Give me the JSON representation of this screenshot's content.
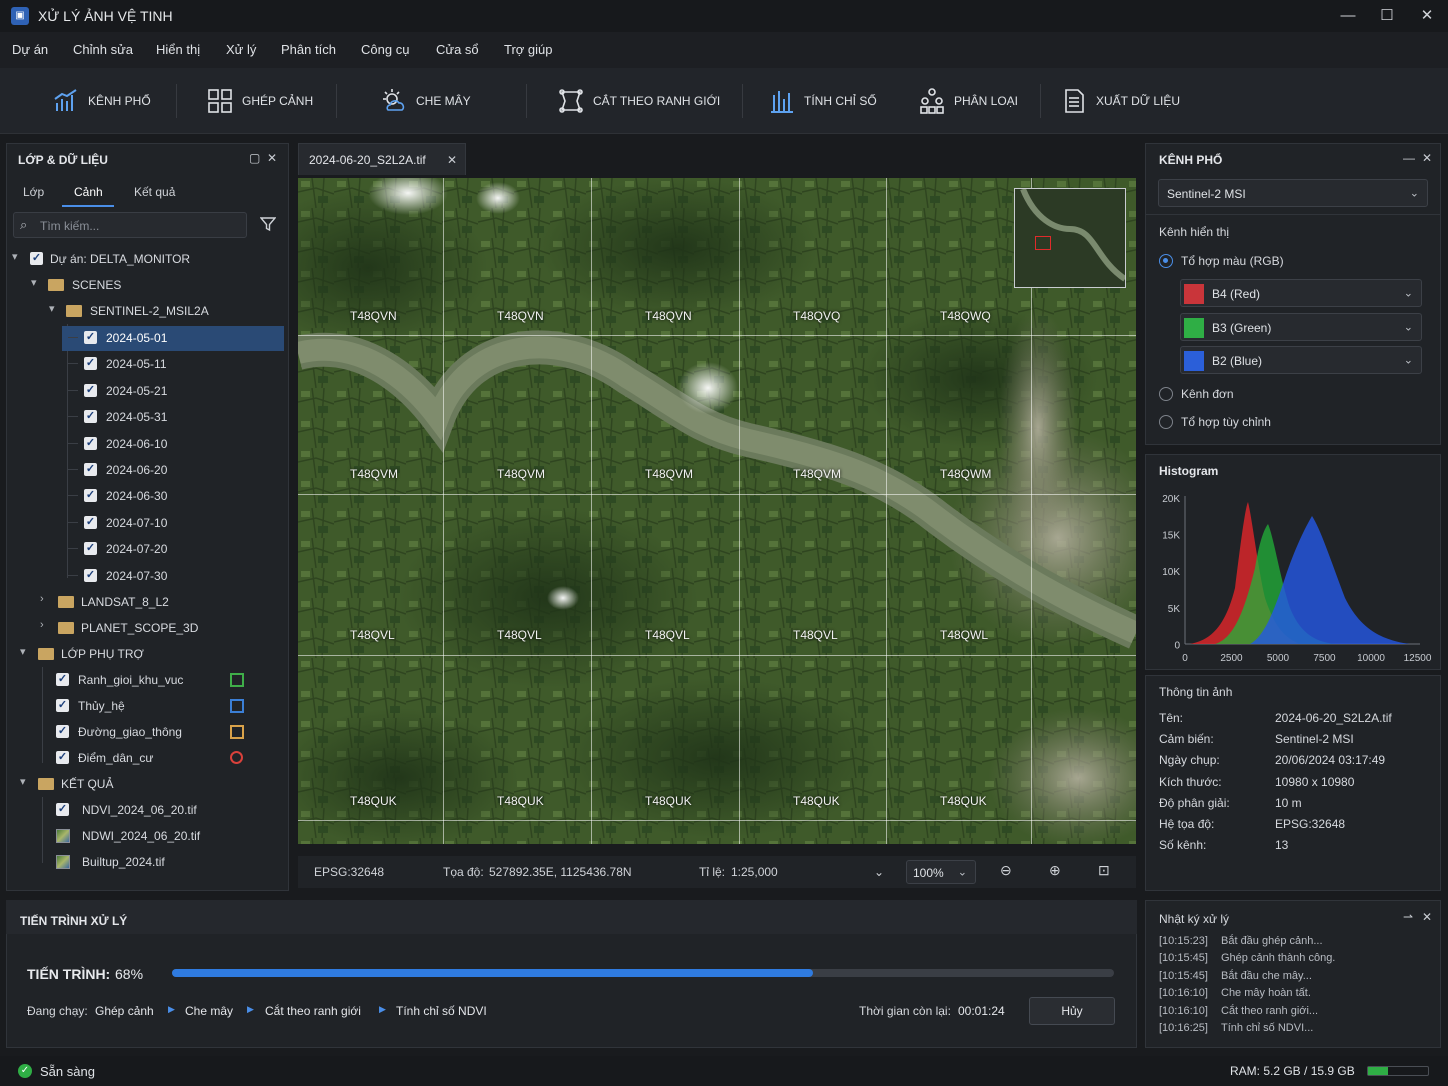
{
  "app": {
    "title": "XỬ LÝ ẢNH VỆ TINH",
    "icon": "satellite-app-icon"
  },
  "window_controls": {
    "minimize": "—",
    "maximize": "☐",
    "close": "✕"
  },
  "menu": [
    "Dự án",
    "Chỉnh sửa",
    "Hiển thị",
    "Xử lý",
    "Phân tích",
    "Công cụ",
    "Cửa sổ",
    "Trợ giúp"
  ],
  "toolbar": [
    "KÊNH PHỔ",
    "GHÉP CẢNH",
    "CHE MÂY",
    "CẮT THEO RANH GIỚI",
    "TÍNH CHỈ SỐ",
    "PHÂN LOẠI",
    "XUẤT DỮ LIỆU"
  ],
  "left_panel": {
    "title": "LỚP & DỮ LIỆU",
    "tabs": [
      "Lớp",
      "Cảnh",
      "Kết quả"
    ],
    "active_tab": "Cảnh",
    "search_placeholder": "Tìm kiếm...",
    "project": "Dự án: DELTA_MONITOR",
    "scenes": "SCENES",
    "sentinel": "SENTINEL-2_MSIL2A",
    "dates": [
      "2024-05-01",
      "2024-05-11",
      "2024-05-21",
      "2024-05-31",
      "2024-06-10",
      "2024-06-20",
      "2024-06-30",
      "2024-07-10",
      "2024-07-20",
      "2024-07-30"
    ],
    "selected_date": "2024-05-01",
    "landsat": "LANDSAT_8_L2",
    "planet": "PLANET_SCOPE_3D",
    "aux": "LỚP PHỤ TRỢ",
    "aux_layers": [
      {
        "name": "Ranh_gioi_khu_vuc",
        "color": "#3fae49"
      },
      {
        "name": "Thủy_hệ",
        "color": "#3b7fd6"
      },
      {
        "name": "Đường_giao_thông",
        "color": "#d9a24a"
      },
      {
        "name": "Điểm_dân_cư",
        "color": "#d9413b"
      }
    ],
    "results": "KẾT QUẢ",
    "result_layers": [
      "NDVI_2024_06_20.tif",
      "NDWI_2024_06_20.tif",
      "Builtup_2024.tif"
    ]
  },
  "doc_tab": {
    "name": "2024-06-20_S2L2A.tif",
    "close": "✕"
  },
  "map": {
    "tiles": [
      [
        "T48QVN",
        "T48QVN",
        "T48QVN",
        "T48QVQ",
        "T48QWQ"
      ],
      [
        "T48QVM",
        "T48QVM",
        "T48QVM",
        "T48QVM",
        "T48QWM"
      ],
      [
        "T48QVL",
        "T48QVL",
        "T48QVL",
        "T48QVL",
        "T48QWL"
      ],
      [
        "T48QUK",
        "T48QUK",
        "T48QUK",
        "T48QUK",
        "T48QUK"
      ]
    ]
  },
  "map_status": {
    "crs": "EPSG:32648",
    "coord_label": "Tọa độ:",
    "coord": "527892.35E, 1125436.78N",
    "scale_label": "Tỉ lệ:",
    "scale": "1:25,000",
    "zoom": "100%"
  },
  "spectral": {
    "title": "KÊNH PHỔ",
    "sensor": "Sentinel-2 MSI",
    "display_label": "Kênh hiển thị",
    "rgb_option": "Tổ hợp màu (RGB)",
    "bands": [
      {
        "name": "B4 (Red)",
        "color": "#c9353a"
      },
      {
        "name": "B3 (Green)",
        "color": "#2fae45"
      },
      {
        "name": "B2 (Blue)",
        "color": "#2b5fd9"
      }
    ],
    "single": "Kênh đơn",
    "custom": "Tổ hợp tùy chỉnh"
  },
  "histogram": {
    "title": "Histogram",
    "y_ticks": [
      "20K",
      "15K",
      "10K",
      "5K",
      "0"
    ],
    "x_ticks": [
      "0",
      "2500",
      "5000",
      "7500",
      "10000",
      "12500"
    ]
  },
  "image_info": {
    "title": "Thông tin ảnh",
    "rows": [
      [
        "Tên:",
        "2024-06-20_S2L2A.tif"
      ],
      [
        "Cảm biến:",
        "Sentinel-2 MSI"
      ],
      [
        "Ngày chụp:",
        "20/06/2024 03:17:49"
      ],
      [
        "Kích thước:",
        "10980 x 10980"
      ],
      [
        "Độ phân giải:",
        "10 m"
      ],
      [
        "Hệ tọa độ:",
        "EPSG:32648"
      ],
      [
        "Số kênh:",
        "13"
      ]
    ]
  },
  "progress": {
    "title": "TIẾN TRÌNH XỬ LÝ",
    "label": "TIẾN TRÌNH:",
    "percent": "68%",
    "value": 0.68,
    "running_label": "Đang chạy:",
    "steps": [
      "Ghép cảnh",
      "Che mây",
      "Cắt theo ranh giới",
      "Tính chỉ số NDVI"
    ],
    "remaining_label": "Thời gian còn lại:",
    "remaining": "00:01:24",
    "cancel": "Hủy"
  },
  "log": {
    "title": "Nhật ký xử lý",
    "entries": [
      [
        "[10:15:23]",
        "Bắt đầu ghép cảnh..."
      ],
      [
        "[10:15:45]",
        "Ghép cảnh thành công."
      ],
      [
        "[10:15:45]",
        "Bắt đầu che mây..."
      ],
      [
        "[10:16:10]",
        "Che mây hoàn tất."
      ],
      [
        "[10:16:10]",
        "Cắt theo ranh giới..."
      ],
      [
        "[10:16:25]",
        "Tính chỉ số NDVI..."
      ]
    ]
  },
  "status": {
    "ready": "Sẵn sàng",
    "ram": "RAM: 5.2 GB / 15.9 GB",
    "ram_fraction": 0.33
  }
}
